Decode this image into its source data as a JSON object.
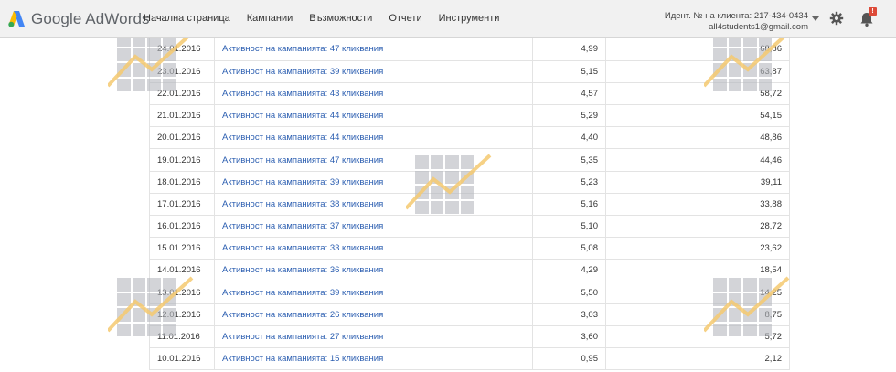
{
  "app": {
    "brand": "Google AdWords"
  },
  "nav": [
    "Начална страница",
    "Кампании",
    "Възможности",
    "Отчети",
    "Инструменти"
  ],
  "account": {
    "client_id": "Идент. № на клиента: 217-434-0434",
    "email": "all4students1@gmail.com"
  },
  "notifications": {
    "badge": "!"
  },
  "icons": {
    "logo": "adwords-logo-icon",
    "settings": "gear-icon",
    "notifications": "bell-icon",
    "account_menu": "chevron-down-icon",
    "watermark": "chart-watermark-icon"
  },
  "colors": {
    "link": "#2a5db0",
    "header_bg": "#f1f1f1",
    "alert": "#dd4b39",
    "watermark_line": "#f5c970"
  },
  "rows": [
    {
      "date": "24.01.2016",
      "campaign": "Активност на кампанията: 47 кликвания",
      "v1": "4,99",
      "v2": "68,86"
    },
    {
      "date": "23.01.2016",
      "campaign": "Активност на кампанията: 39 кликвания",
      "v1": "5,15",
      "v2": "63,87"
    },
    {
      "date": "22.01.2016",
      "campaign": "Активност на кампанията: 43 кликвания",
      "v1": "4,57",
      "v2": "58,72"
    },
    {
      "date": "21.01.2016",
      "campaign": "Активност на кампанията: 44 кликвания",
      "v1": "5,29",
      "v2": "54,15"
    },
    {
      "date": "20.01.2016",
      "campaign": "Активност на кампанията: 44 кликвания",
      "v1": "4,40",
      "v2": "48,86"
    },
    {
      "date": "19.01.2016",
      "campaign": "Активност на кампанията: 47 кликвания",
      "v1": "5,35",
      "v2": "44,46"
    },
    {
      "date": "18.01.2016",
      "campaign": "Активност на кампанията: 39 кликвания",
      "v1": "5,23",
      "v2": "39,11"
    },
    {
      "date": "17.01.2016",
      "campaign": "Активност на кампанията: 38 кликвания",
      "v1": "5,16",
      "v2": "33,88"
    },
    {
      "date": "16.01.2016",
      "campaign": "Активност на кампанията: 37 кликвания",
      "v1": "5,10",
      "v2": "28,72"
    },
    {
      "date": "15.01.2016",
      "campaign": "Активност на кампанията: 33 кликвания",
      "v1": "5,08",
      "v2": "23,62"
    },
    {
      "date": "14.01.2016",
      "campaign": "Активност на кампанията: 36 кликвания",
      "v1": "4,29",
      "v2": "18,54"
    },
    {
      "date": "13.01.2016",
      "campaign": "Активност на кампанията: 39 кликвания",
      "v1": "5,50",
      "v2": "14,25"
    },
    {
      "date": "12.01.2016",
      "campaign": "Активност на кампанията: 26 кликвания",
      "v1": "3,03",
      "v2": "8,75"
    },
    {
      "date": "11.01.2016",
      "campaign": "Активност на кампанията: 27 кликвания",
      "v1": "3,60",
      "v2": "5,72"
    },
    {
      "date": "10.01.2016",
      "campaign": "Активност на кампанията: 15 кликвания",
      "v1": "0,95",
      "v2": "2,12"
    }
  ]
}
